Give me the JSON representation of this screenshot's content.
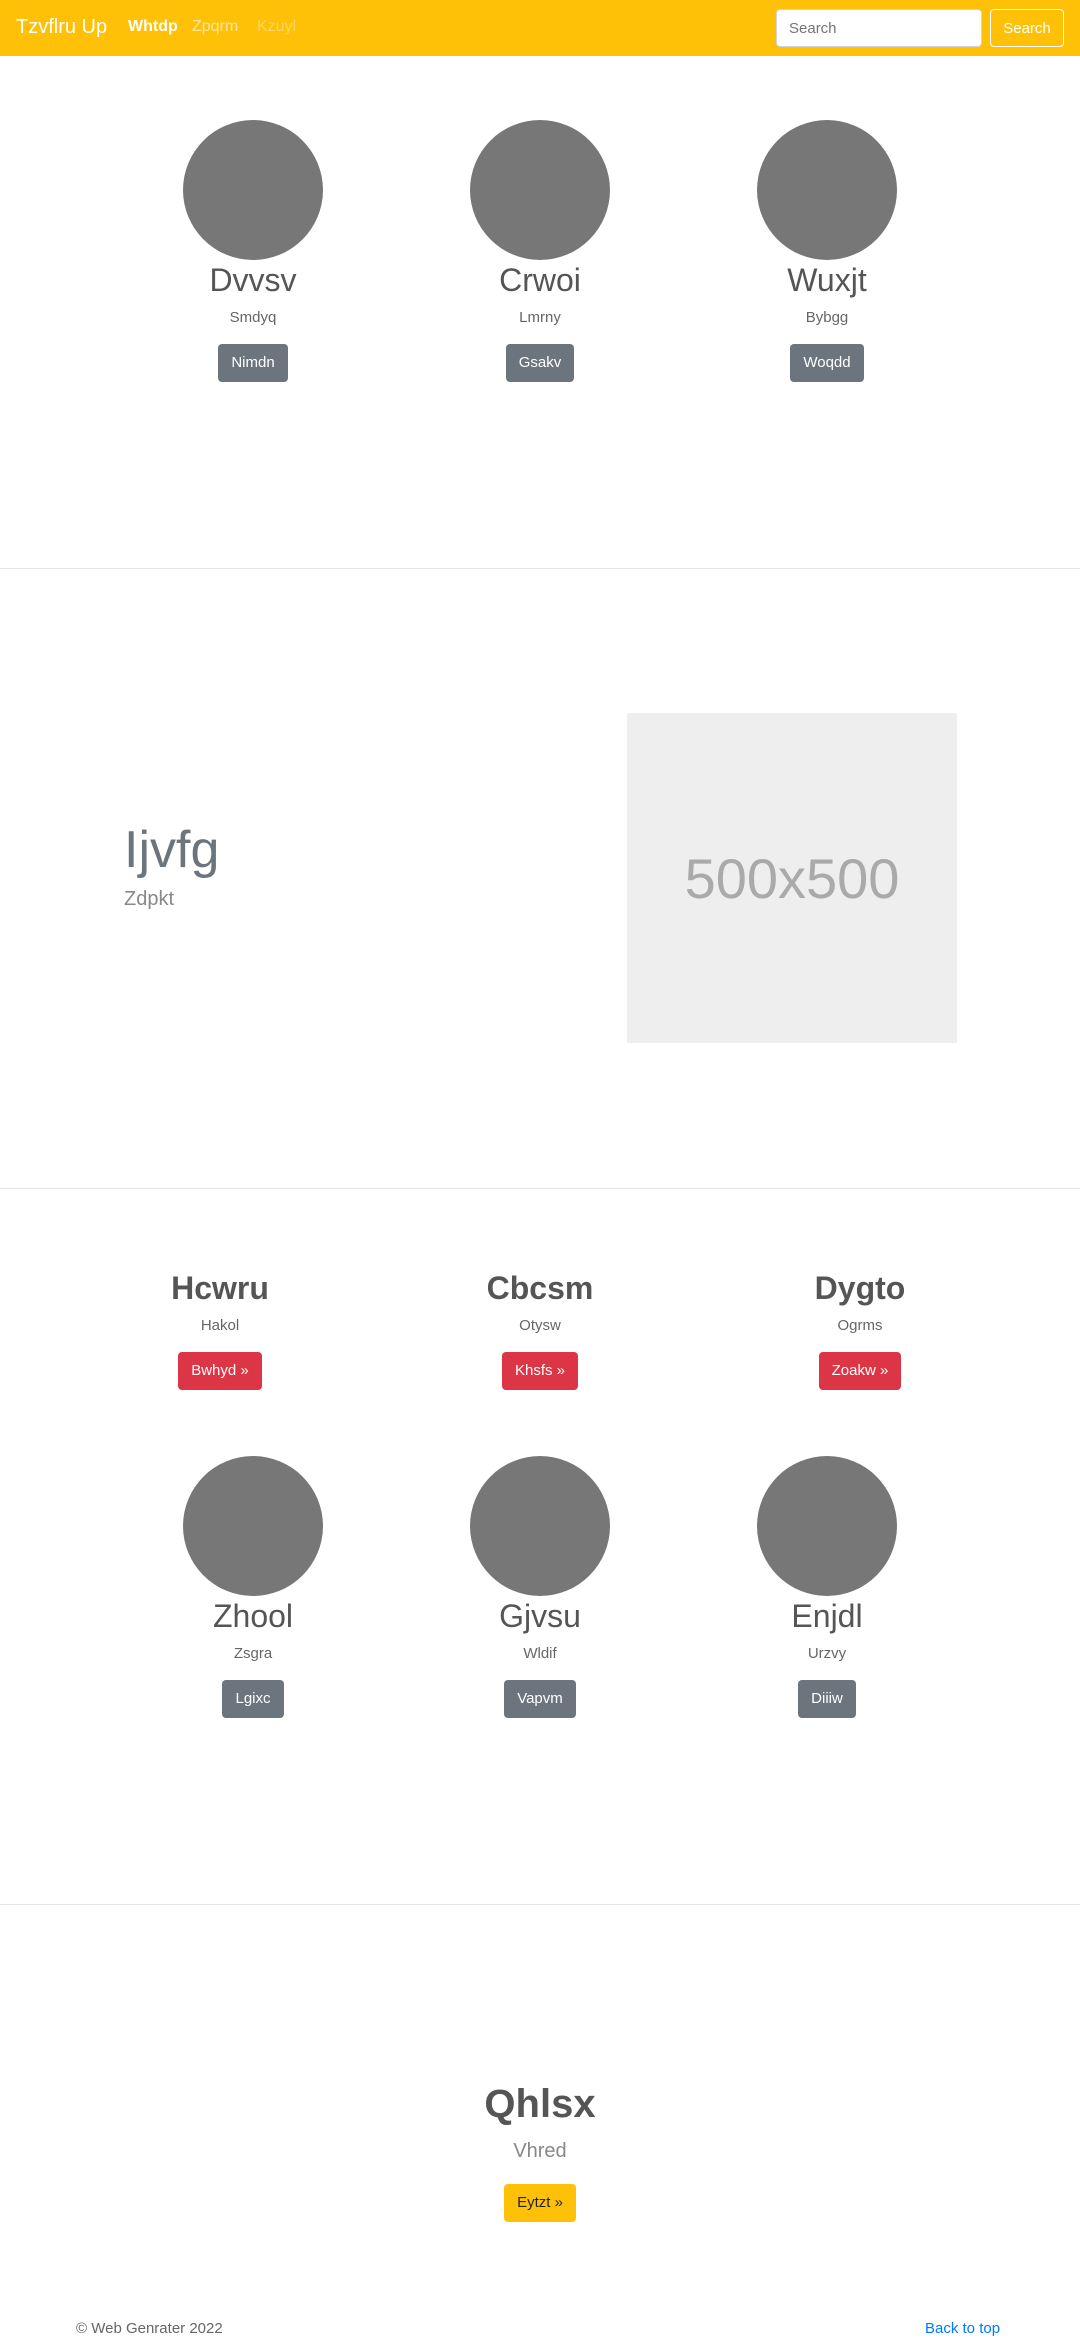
{
  "navbar": {
    "brand": "Tzvflru Up",
    "links": [
      "Whtdp",
      "Zpqrm",
      "Kzuyl"
    ],
    "search_placeholder": "Search",
    "search_button": "Search",
    "colors": {
      "background": "#ffc107"
    }
  },
  "team_top": [
    {
      "name": "Dvvsv",
      "subtitle": "Smdyq",
      "button": "Nimdn"
    },
    {
      "name": "Crwoi",
      "subtitle": "Lmrny",
      "button": "Gsakv"
    },
    {
      "name": "Wuxjt",
      "subtitle": "Bybgg",
      "button": "Woqdd"
    }
  ],
  "feature": {
    "title": "Ijvfg",
    "subtitle": "Zdpkt",
    "image_placeholder": "500x500"
  },
  "highlights": [
    {
      "title": "Hcwru",
      "subtitle": "Hakol",
      "button": "Bwhyd »"
    },
    {
      "title": "Cbcsm",
      "subtitle": "Otysw",
      "button": "Khsfs »"
    },
    {
      "title": "Dygto",
      "subtitle": "Ogrms",
      "button": "Zoakw »"
    }
  ],
  "team_bottom": [
    {
      "name": "Zhool",
      "subtitle": "Zsgra",
      "button": "Lgixc"
    },
    {
      "name": "Gjvsu",
      "subtitle": "Wldif",
      "button": "Vapvm"
    },
    {
      "name": "Enjdl",
      "subtitle": "Urzvy",
      "button": "Diiiw"
    }
  ],
  "hero": {
    "title": "Qhlsx",
    "subtitle": "Vhred",
    "button": "Eytzt »"
  },
  "footer": {
    "copyright": "© Web Genrater 2022",
    "back_to_top": "Back to top"
  }
}
